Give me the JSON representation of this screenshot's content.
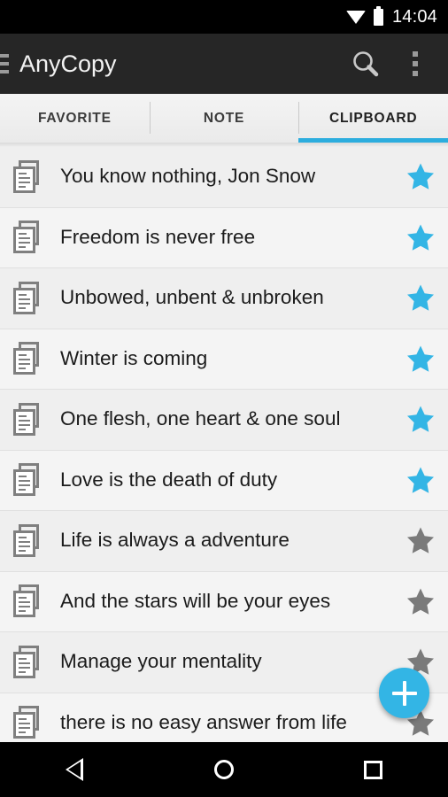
{
  "status_bar": {
    "time": "14:04",
    "wifi_icon": "wifi-icon",
    "battery_icon": "battery-icon"
  },
  "action_bar": {
    "drawer_icon": "hamburger-menu-icon",
    "title": "AnyCopy",
    "search_icon": "search-icon",
    "overflow_icon": "overflow-menu-icon"
  },
  "tabs": [
    {
      "label": "FAVORITE",
      "active": false
    },
    {
      "label": "NOTE",
      "active": false
    },
    {
      "label": "CLIPBOARD",
      "active": true
    }
  ],
  "colors": {
    "accent": "#33b5e5",
    "tab_indicator": "#2cadde",
    "star_on": "#33b5e5",
    "star_off": "#7a7a7a",
    "action_bar": "#262626",
    "list_background": "#efefef"
  },
  "list": {
    "item_icon": "copy-document-icon",
    "items": [
      {
        "text": "You know nothing, Jon Snow",
        "favorited": true
      },
      {
        "text": "Freedom is never free",
        "favorited": true
      },
      {
        "text": "Unbowed, unbent & unbroken",
        "favorited": true
      },
      {
        "text": "Winter is coming",
        "favorited": true
      },
      {
        "text": "One flesh, one heart & one soul",
        "favorited": true
      },
      {
        "text": "Love is the death of duty",
        "favorited": true
      },
      {
        "text": "Life is always a adventure",
        "favorited": false
      },
      {
        "text": "And the stars will be your eyes",
        "favorited": false
      },
      {
        "text": "Manage your mentality",
        "favorited": false
      },
      {
        "text": "there is no easy answer from life",
        "favorited": false
      }
    ]
  },
  "fab": {
    "icon": "plus-icon",
    "label": "+"
  },
  "nav_bar": {
    "back_icon": "back-triangle-icon",
    "home_icon": "home-circle-icon",
    "recents_icon": "recents-square-icon"
  }
}
